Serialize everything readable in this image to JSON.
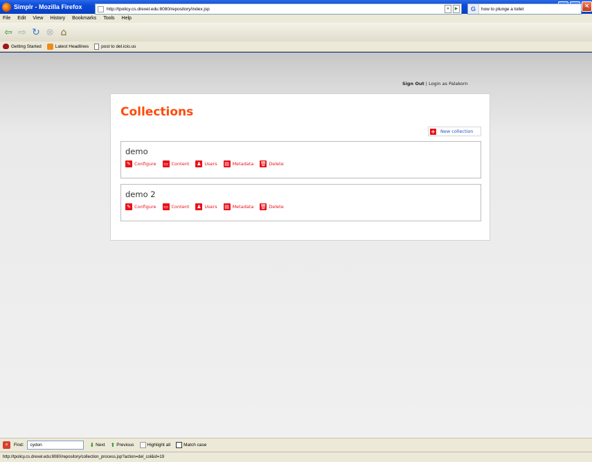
{
  "window": {
    "title": "Simplr - Mozilla Firefox"
  },
  "menu": [
    "File",
    "Edit",
    "View",
    "History",
    "Bookmarks",
    "Tools",
    "Help"
  ],
  "address": {
    "url": "http://tpolicy.cs.drexel.edu:8080/repository/index.jsp"
  },
  "search": {
    "value": "how to plunge a toilet"
  },
  "bookmarks": [
    "Getting Started",
    "Latest Headlines",
    "post to del.icio.us"
  ],
  "header": {
    "sign_out": "Sign Out",
    "separator": "|",
    "login_as": "Login as Palakorn"
  },
  "page": {
    "title": "Collections",
    "new_collection": "New collection"
  },
  "actions": [
    "Configure",
    "Content",
    "Users",
    "Metadata",
    "Delete"
  ],
  "collections": [
    {
      "name": "demo"
    },
    {
      "name": "demo 2"
    }
  ],
  "findbar": {
    "label": "Find:",
    "value": "cydon",
    "next": "Next",
    "previous": "Previous",
    "highlight_all": "Highlight all",
    "match_case": "Match case"
  },
  "status": {
    "text": "http://tpolicy.cs.drexel.edu:8080/repository/collection_process.jsp?action=del_col&id=19"
  },
  "colors": {
    "accent": "#ff4a0a",
    "action_red": "#e8121a",
    "link_blue": "#2255bb"
  }
}
